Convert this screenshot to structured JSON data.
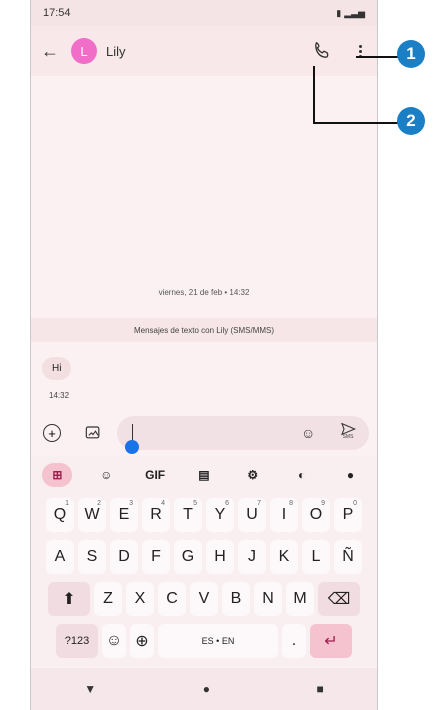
{
  "status": {
    "time": "17:54"
  },
  "header": {
    "back": "←",
    "avatar_letter": "L",
    "contact_name": "Lily"
  },
  "conversation": {
    "date": "viernes, 21 de feb • 14:32",
    "sms_notice": "Mensajes de texto con Lily (SMS/MMS)",
    "message": "Hi",
    "message_time": "14:32"
  },
  "compose": {
    "send_label": "SMS"
  },
  "keyboard": {
    "toolbar": {
      "gif": "GIF"
    },
    "rows": [
      [
        "Q",
        "W",
        "E",
        "R",
        "T",
        "Y",
        "U",
        "I",
        "O",
        "P"
      ],
      [
        "A",
        "S",
        "D",
        "F",
        "G",
        "H",
        "J",
        "K",
        "L",
        "Ñ"
      ],
      [
        "Z",
        "X",
        "C",
        "V",
        "B",
        "N",
        "M"
      ]
    ],
    "numbers": [
      "1",
      "2",
      "3",
      "4",
      "5",
      "6",
      "7",
      "8",
      "9",
      "0"
    ],
    "symbols_key": "?123",
    "space_label": "ES • EN",
    "period": "."
  },
  "callouts": [
    "1",
    "2"
  ],
  "colors": {
    "accent": "#1b7fc6",
    "avatar": "#f06ec8",
    "keyboard_accent": "#f5c2cf"
  }
}
